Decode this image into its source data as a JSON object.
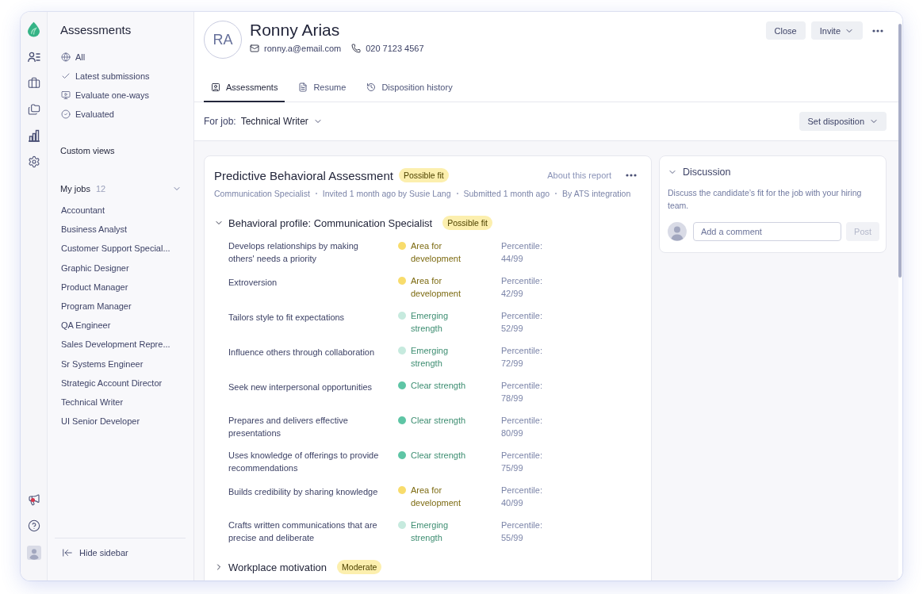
{
  "rail": {
    "announcements_unread": true
  },
  "sidebar": {
    "title": "Assessments",
    "views": [
      {
        "label": "All",
        "kind": "all"
      },
      {
        "label": "Latest submissions",
        "kind": "latest"
      },
      {
        "label": "Evaluate one-ways",
        "kind": "video"
      },
      {
        "label": "Evaluated",
        "kind": "evaluated"
      }
    ],
    "custom_views": "Custom views",
    "my_jobs": {
      "label": "My jobs",
      "count": "12",
      "expanded": true,
      "jobs": [
        "Accountant",
        "Business Analyst",
        "Customer Support Special...",
        "Graphic Designer",
        "Product Manager",
        "Program Manager",
        "QA Engineer",
        "Sales Development Repre...",
        "Sr Systems Engineer",
        "Strategic Account Director",
        "Technical Writer",
        "UI Senior Developer"
      ]
    },
    "hide_sidebar": "Hide sidebar"
  },
  "candidate": {
    "initials": "RA",
    "name": "Ronny Arias",
    "email": "ronny.a@email.com",
    "phone": "020 7123 4567"
  },
  "actions": [
    {
      "label": "Close",
      "kind": "plain"
    },
    {
      "label": "Invite",
      "kind": "menu"
    }
  ],
  "tabs": [
    {
      "label": "Assessments",
      "kind": "assessments",
      "selected": true
    },
    {
      "label": "Resume",
      "kind": "resume",
      "selected": false
    },
    {
      "label": "Disposition history",
      "kind": "history",
      "selected": false
    }
  ],
  "job_filter": {
    "label": "For job:",
    "value": "Technical Writer"
  },
  "set_disposition": "Set disposition",
  "assessment": {
    "title": "Predictive Behavioral Assessment",
    "badge": "Possible fit",
    "about_link": "About this report",
    "meta": [
      "Communication Specialist",
      "Invited 1 month ago by Susie Lang",
      "Submitted 1 month ago",
      "By ATS integration"
    ],
    "sections": [
      {
        "title": "Behavioral profile: Communication Specialist",
        "badge": "Possible fit",
        "expanded": true,
        "traits": [
          {
            "label": "Develops relationships by making others' needs a priority",
            "status": "Area for development",
            "kind": "development",
            "color": "#f8dc6c",
            "percentile": "Percentile: 44/99"
          },
          {
            "label": "Extroversion",
            "status": "Area for development",
            "kind": "development",
            "color": "#f8dc6c",
            "percentile": "Percentile: 42/99"
          },
          {
            "label": "Tailors style to fit expectations",
            "status": "Emerging strength",
            "kind": "emerging",
            "color": "#c6eade",
            "percentile": "Percentile: 52/99"
          },
          {
            "label": "Influence others through collaboration",
            "status": "Emerging strength",
            "kind": "emerging",
            "color": "#c6eade",
            "percentile": "Percentile: 72/99"
          },
          {
            "label": "Seek new interpersonal opportunities",
            "status": "Clear strength",
            "kind": "clear",
            "color": "#5ec5a5",
            "percentile": "Percentile: 78/99"
          },
          {
            "label": "Prepares and delivers effective presentations",
            "status": "Clear strength",
            "kind": "clear",
            "color": "#5ec5a5",
            "percentile": "Percentile: 80/99"
          },
          {
            "label": "Uses knowledge of offerings to provide recommendations",
            "status": "Clear strength",
            "kind": "clear",
            "color": "#5ec5a5",
            "percentile": "Percentile: 75/99"
          },
          {
            "label": "Builds credibility by sharing knowledge",
            "status": "Area for development",
            "kind": "development",
            "color": "#f8dc6c",
            "percentile": "Percentile: 40/99"
          },
          {
            "label": "Crafts written communications that are precise and deliberate",
            "status": "Emerging strength",
            "kind": "emerging",
            "color": "#c6eade",
            "percentile": "Percentile: 55/99"
          }
        ]
      },
      {
        "title": "Workplace motivation",
        "badge": "Moderate",
        "expanded": false
      }
    ]
  },
  "discussion": {
    "title": "Discussion",
    "expanded": true,
    "description": "Discuss the candidate’s fit for the job with your hiring team.",
    "comment_placeholder": "Add a comment",
    "post_button": {
      "label": "Post",
      "disabled": true
    }
  }
}
